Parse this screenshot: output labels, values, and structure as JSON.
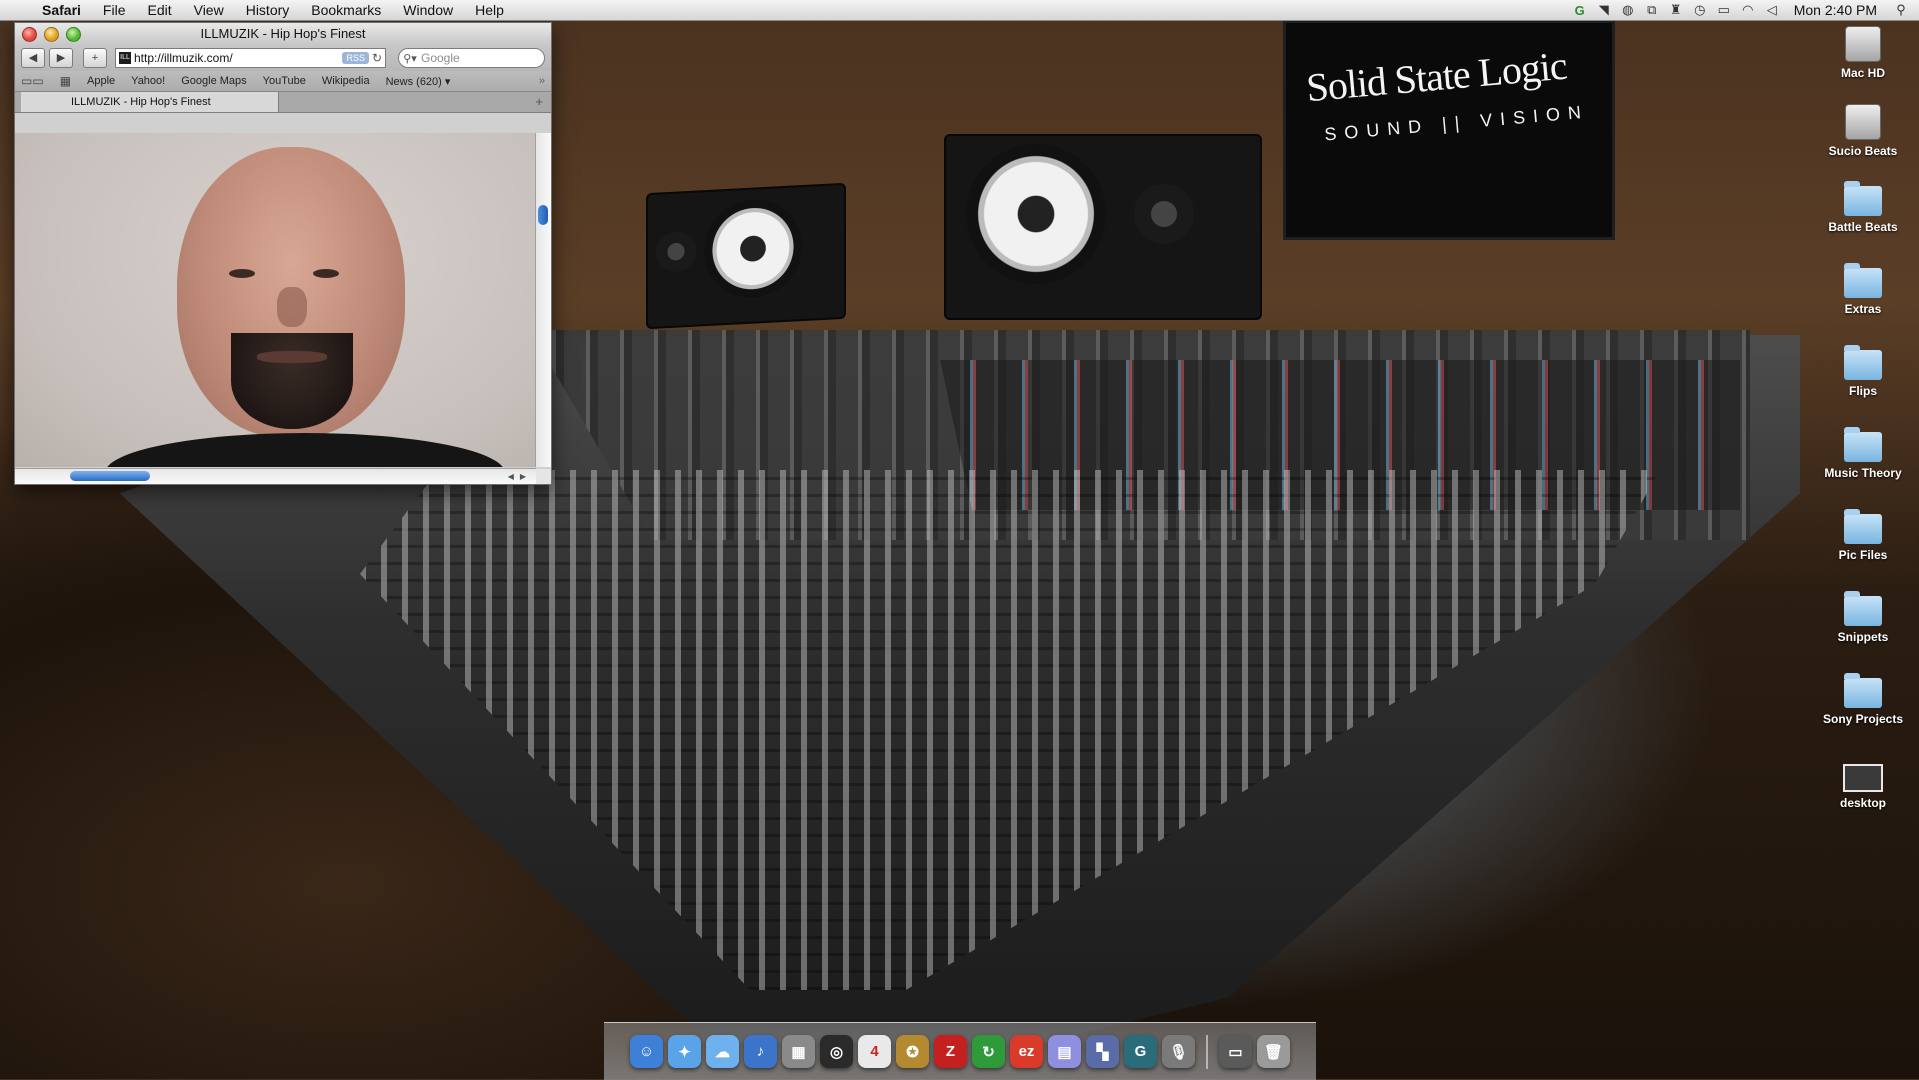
{
  "menubar": {
    "app_name": "Safari",
    "menus": [
      "File",
      "Edit",
      "View",
      "History",
      "Bookmarks",
      "Window",
      "Help"
    ],
    "clock": "Mon 2:40 PM"
  },
  "browser": {
    "window_title": "ILLMUZIK - Hip Hop's Finest",
    "url": "http://illmuzik.com/",
    "rss_label": "RSS",
    "search_placeholder": "Google",
    "bookmarks": [
      "Apple",
      "Yahoo!",
      "Google Maps",
      "YouTube",
      "Wikipedia",
      "News (620) ▾"
    ],
    "tab_title": "ILLMUZIK - Hip Hop's Finest"
  },
  "wallpaper": {
    "brand": "Solid State Logic",
    "tagline": "SOUND || VISION"
  },
  "desktop_icons": [
    {
      "label": "Mac HD",
      "icon": "hard-drive-icon"
    },
    {
      "label": "Sucio Beats",
      "icon": "hard-drive-icon"
    },
    {
      "label": "Battle Beats",
      "icon": "folder-icon"
    },
    {
      "label": "Extras",
      "icon": "folder-icon"
    },
    {
      "label": "Flips",
      "icon": "folder-icon"
    },
    {
      "label": "Music Theory",
      "icon": "folder-icon"
    },
    {
      "label": "Pic Files",
      "icon": "folder-icon"
    },
    {
      "label": "Snippets",
      "icon": "folder-icon"
    },
    {
      "label": "Sony Projects",
      "icon": "folder-icon"
    },
    {
      "label": "desktop",
      "icon": "image-file-icon"
    }
  ],
  "dock": {
    "items": [
      {
        "name": "finder-icon",
        "glyph": "☺",
        "color": "#3e7fd8"
      },
      {
        "name": "safari-icon",
        "glyph": "✦",
        "color": "#5aa3e8"
      },
      {
        "name": "ichat-icon",
        "glyph": "☁",
        "color": "#6fb1ef"
      },
      {
        "name": "itunes-icon",
        "glyph": "♪",
        "color": "#3b74c9"
      },
      {
        "name": "preview-icon",
        "glyph": "▦",
        "color": "#8a8a8a"
      },
      {
        "name": "dashboard-icon",
        "glyph": "◎",
        "color": "#2a2a2a"
      },
      {
        "name": "ical-icon",
        "glyph": "4",
        "color": "#e9e9e9"
      },
      {
        "name": "compass-icon",
        "glyph": "✪",
        "color": "#b48a30"
      },
      {
        "name": "filezilla-icon",
        "glyph": "Z",
        "color": "#c52020"
      },
      {
        "name": "app-green-icon",
        "glyph": "↻",
        "color": "#2f9a3a"
      },
      {
        "name": "ez-icon",
        "glyph": "ez",
        "color": "#d93a2a"
      },
      {
        "name": "files-icon",
        "glyph": "▤",
        "color": "#8f8fe0"
      },
      {
        "name": "windows-icon",
        "glyph": "▚",
        "color": "#5a6ca8"
      },
      {
        "name": "g-icon",
        "glyph": "G",
        "color": "#2b6c7a"
      },
      {
        "name": "microphone-icon",
        "glyph": "🎙",
        "color": "#7a7a7a"
      }
    ],
    "trailing": [
      {
        "name": "downloads-icon",
        "glyph": "▭",
        "color": "#5a5a5a"
      },
      {
        "name": "trash-icon",
        "glyph": "🗑",
        "color": "#9a9a9a"
      }
    ]
  }
}
